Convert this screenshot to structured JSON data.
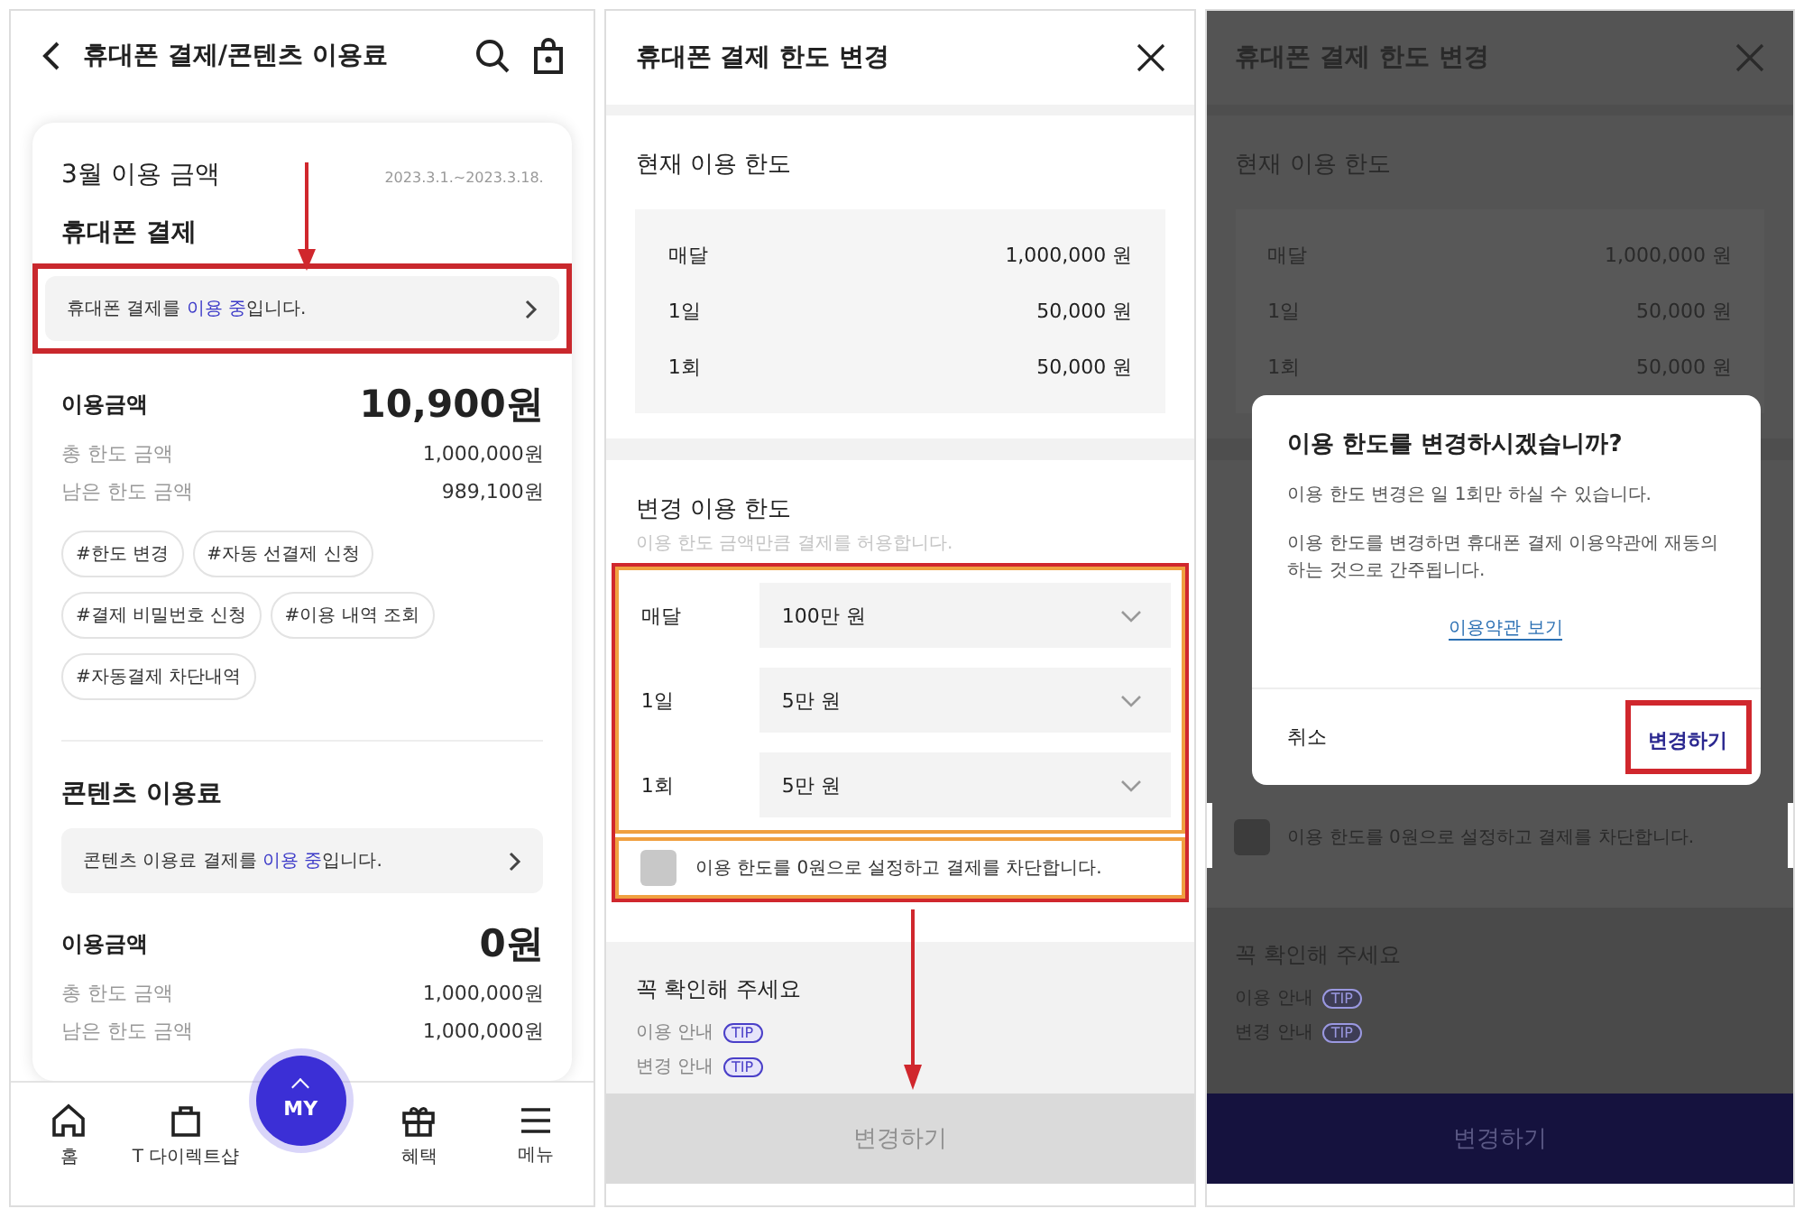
{
  "usage_screen": {
    "header": {
      "title": "휴대폰 결제/콘텐츠 이용료"
    },
    "sections": [
      {
        "month_title": "3월 이용 금액",
        "period": "2023.3.1.~2023.3.18.",
        "title": "휴대폰 결제",
        "notice": [
          {
            "text": "휴대폰 결제를 ",
            "highlight": false
          },
          {
            "text": "이용 중",
            "highlight": true
          },
          {
            "text": "입니다.",
            "highlight": false
          }
        ],
        "amount_label": "이용금액",
        "amount": "10,900원",
        "details": [
          {
            "label": "총 한도 금액",
            "value": "1,000,000원"
          },
          {
            "label": "남은 한도 금액",
            "value": "989,100원"
          }
        ],
        "tags": [
          "#한도 변경",
          "#자동 선결제 신청",
          "#결제 비밀번호 신청",
          "#이용 내역 조회",
          "#자동결제 차단내역"
        ]
      },
      {
        "title": "콘텐츠 이용료",
        "notice": [
          {
            "text": "콘텐츠 이용료 결제를 ",
            "highlight": false
          },
          {
            "text": "이용 중",
            "highlight": true
          },
          {
            "text": "입니다.",
            "highlight": false
          }
        ],
        "amount_label": "이용금액",
        "amount": "0원",
        "details": [
          {
            "label": "총 한도 금액",
            "value": "1,000,000원"
          },
          {
            "label": "남은 한도 금액",
            "value": "1,000,000원"
          }
        ]
      }
    ],
    "nav": [
      {
        "label": "홈",
        "kind": "home"
      },
      {
        "label": "T 다이렉트샵",
        "kind": "shop"
      },
      {
        "label": "MY",
        "kind": "my"
      },
      {
        "label": "혜택",
        "kind": "gift"
      },
      {
        "label": "메뉴",
        "kind": "menu"
      }
    ]
  },
  "limit_screen": {
    "header": {
      "title": "휴대폰 결제 한도 변경"
    },
    "current": {
      "title": "현재 이용 한도",
      "rows": [
        {
          "label": "매달",
          "value": "1,000,000 원"
        },
        {
          "label": "1일",
          "value": "50,000 원"
        },
        {
          "label": "1회",
          "value": "50,000 원"
        }
      ]
    },
    "change": {
      "title": "변경 이용 한도",
      "hint": "이용 한도 금액만큼 결제를 허용합니다.",
      "selects": [
        {
          "label": "매달",
          "value": "100만 원"
        },
        {
          "label": "1일",
          "value": "5만 원"
        },
        {
          "label": "1회",
          "value": "5만 원"
        }
      ]
    },
    "block": {
      "label": "이용 한도를 0원으로 설정하고 결제를 차단합니다.",
      "checked": false
    },
    "notes": {
      "title": "꼭 확인해 주세요",
      "items": [
        {
          "label": "이용 안내",
          "badge": "TIP"
        },
        {
          "label": "변경 안내",
          "badge": "TIP"
        }
      ]
    },
    "submit": {
      "label": "변경하기",
      "disabled": true
    }
  },
  "confirm_screen": {
    "header": {
      "title": "휴대폰 결제 한도 변경"
    },
    "current": {
      "title": "현재 이용 한도",
      "rows": [
        {
          "label": "매달",
          "value": "1,000,000 원"
        },
        {
          "label": "1일",
          "value": "50,000 원"
        },
        {
          "label": "1회",
          "value": "50,000 원"
        }
      ]
    },
    "block": {
      "label": "이용 한도를 0원으로 설정하고 결제를 차단합니다.",
      "checked": false
    },
    "notes": {
      "title": "꼭 확인해 주세요",
      "items": [
        {
          "label": "이용 안내",
          "badge": "TIP"
        },
        {
          "label": "변경 안내",
          "badge": "TIP"
        }
      ]
    },
    "submit": {
      "label": "변경하기",
      "disabled": false
    },
    "dialog": {
      "title": "이용 한도를 변경하시겠습니까?",
      "messages": [
        "이용 한도 변경은 일 1회만 하실 수 있습니다.",
        "이용 한도를 변경하면 휴대폰 결제 이용약관에 재동의하는 것으로 간주됩니다."
      ],
      "link": "이용약관 보기",
      "buttons": [
        {
          "label": "취소",
          "kind": "cancel"
        },
        {
          "label": "변경하기",
          "kind": "confirm"
        }
      ]
    }
  }
}
